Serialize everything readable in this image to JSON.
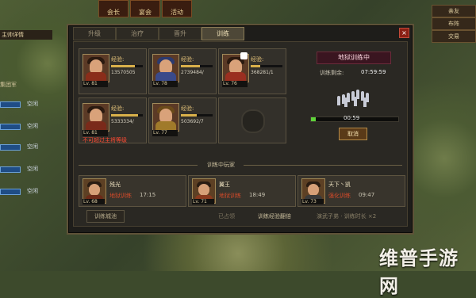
{
  "top_tabs": [
    "会长",
    "宴会",
    "活动"
  ],
  "left_panel": {
    "title": "主帅详情",
    "subtitle": "集团军",
    "slots": [
      "空闲",
      "空闲",
      "空闲",
      "空闲",
      "空闲"
    ]
  },
  "right_panel": {
    "buttons": [
      "亲友",
      "布阵",
      "交易"
    ]
  },
  "dialog": {
    "tabs": [
      "升级",
      "治疗",
      "晋升",
      "训练"
    ],
    "active_tab": 3,
    "close_label": "×"
  },
  "generals": [
    {
      "exp_label": "经验:",
      "exp_value": "13570505",
      "level": "Lv. 81",
      "progress": 0.75
    },
    {
      "exp_label": "经验:",
      "exp_value": "2739484/",
      "level": "Lv. 78",
      "progress": 0.6
    },
    {
      "exp_label": "经验:",
      "exp_value": "368281/1",
      "level": "Lv. 76",
      "progress": 0.3
    },
    {
      "exp_label": "经验:",
      "exp_value": "5333334/",
      "level": "Lv. 81",
      "progress": 0.85,
      "warning": "不可超过主将等级"
    },
    {
      "exp_label": "经验:",
      "exp_value": "503692/7",
      "level": "Lv. 77",
      "progress": 0.5
    }
  ],
  "training_status": {
    "title": "地狱训练中",
    "rest_label": "训练剩余:",
    "rest_time": "07:59:59",
    "progress_time": "00:59",
    "progress": 0.05,
    "collect_label": "取消"
  },
  "friends_divider": "训练中玩家",
  "friends": [
    {
      "name": "残光",
      "level": "Lv. 68",
      "status": "地狱训练",
      "time": "17:15"
    },
    {
      "name": "翼王",
      "level": "Lv. 71",
      "status": "地狱训练",
      "time": "18:49"
    },
    {
      "name": "天下丶凯",
      "level": "Lv. 73",
      "status": "强化训练",
      "time": "09:47"
    }
  ],
  "footer": {
    "camp_button": "训练城池",
    "info_a": "已占领",
    "info_b": "训练经验翻倍",
    "info_c": "演武子弟 · 训练时长 ×2"
  },
  "watermark": "维普手游网",
  "colors": {
    "warning": "#ff4a33",
    "progress_green": "#5fd33a",
    "gold": "#d9b04a"
  }
}
